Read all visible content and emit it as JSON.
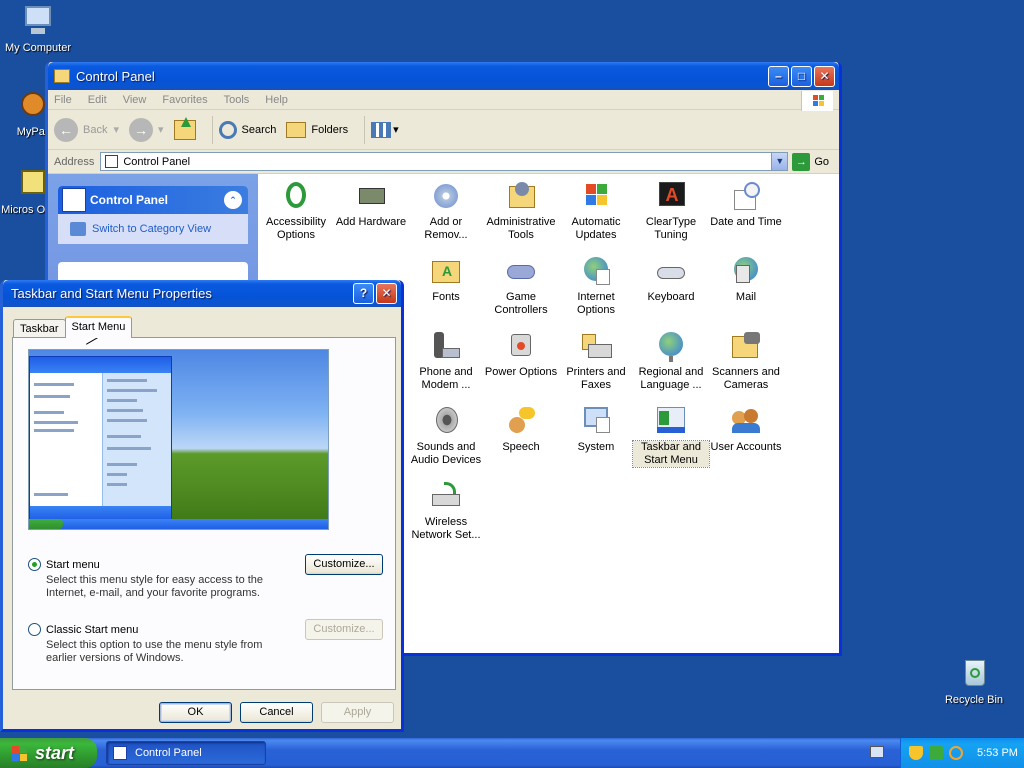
{
  "desktop": {
    "icons": [
      {
        "label": "My Computer"
      },
      {
        "label": "MyPal"
      },
      {
        "label": "Micros Outlo"
      },
      {
        "label": "Recycle Bin"
      }
    ]
  },
  "control_panel": {
    "title": "Control Panel",
    "menu": [
      "File",
      "Edit",
      "View",
      "Favorites",
      "Tools",
      "Help"
    ],
    "toolbar": {
      "back": "Back",
      "search": "Search",
      "folders": "Folders"
    },
    "address_label": "Address",
    "address_value": "Control Panel",
    "go_label": "Go",
    "taskpane": {
      "header": "Control Panel",
      "link": "Switch to Category View"
    },
    "items": [
      {
        "label": "Accessibility Options"
      },
      {
        "label": "Add Hardware"
      },
      {
        "label": "Add or Remov..."
      },
      {
        "label": "Administrative Tools"
      },
      {
        "label": "Automatic Updates"
      },
      {
        "label": "ClearType Tuning"
      },
      {
        "label": "Date and Time"
      },
      {
        "label": "Fonts"
      },
      {
        "label": "Game Controllers"
      },
      {
        "label": "Internet Options"
      },
      {
        "label": "Keyboard"
      },
      {
        "label": "Mail"
      },
      {
        "label": "Phone and Modem ..."
      },
      {
        "label": "Power Options"
      },
      {
        "label": "Printers and Faxes"
      },
      {
        "label": "Regional and Language ..."
      },
      {
        "label": "Scanners and Cameras"
      },
      {
        "label": "Sounds and Audio Devices"
      },
      {
        "label": "Speech"
      },
      {
        "label": "System"
      },
      {
        "label": "Taskbar and Start Menu"
      },
      {
        "label": "User Accounts"
      },
      {
        "label": "Wireless Network Set..."
      }
    ]
  },
  "dialog": {
    "title": "Taskbar and Start Menu Properties",
    "tabs": [
      {
        "label": "Taskbar"
      },
      {
        "label": "Start Menu"
      }
    ],
    "options": {
      "start_menu": {
        "label": "Start menu",
        "description": "Select this menu style for easy access to the Internet, e-mail, and your favorite programs.",
        "selected": true
      },
      "classic": {
        "label": "Classic Start menu",
        "description": "Select this option to use the menu style from earlier versions of Windows.",
        "selected": false
      }
    },
    "customize_label": "Customize...",
    "ok_label": "OK",
    "cancel_label": "Cancel",
    "apply_label": "Apply"
  },
  "taskbar": {
    "start_label": "start",
    "task_item": "Control Panel",
    "clock": "5:53 PM"
  }
}
